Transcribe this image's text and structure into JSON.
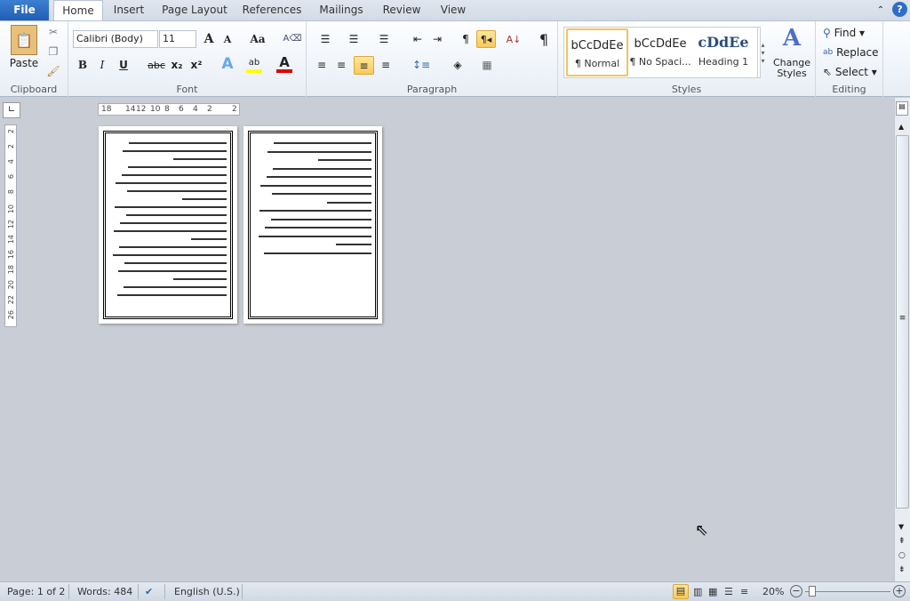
{
  "tabs": [
    {
      "label": "File"
    },
    {
      "label": "Home"
    },
    {
      "label": "Insert"
    },
    {
      "label": "Page Layout"
    },
    {
      "label": "References"
    },
    {
      "label": "Mailings"
    },
    {
      "label": "Review"
    },
    {
      "label": "View"
    }
  ],
  "clipboard": {
    "paste": "Paste",
    "label": "Clipboard"
  },
  "font": {
    "name": "Calibri (Body)",
    "size": "11",
    "label": "Font",
    "change_case": "Aa",
    "bold": "B",
    "italic": "I",
    "underline": "U",
    "strike": "abc",
    "sub": "x₂",
    "sup": "x²",
    "highlight": "ab",
    "color": "A",
    "grow": "A",
    "shrink": "A"
  },
  "paragraph": {
    "label": "Paragraph",
    "pilcrow": "¶"
  },
  "styles": {
    "label": "Styles",
    "items": [
      {
        "preview": "bCcDdEe",
        "name": "¶ Normal"
      },
      {
        "preview": "bCcDdEe",
        "name": "¶ No Spaci..."
      },
      {
        "preview": "cDdEe",
        "name": "Heading 1"
      }
    ],
    "change": "Change Styles"
  },
  "editing": {
    "label": "Editing",
    "find": "Find",
    "replace": "Replace",
    "select": "Select"
  },
  "ruler": {
    "h": [
      "18",
      "14",
      "12",
      "10",
      "8",
      "6",
      "4",
      "2",
      "2"
    ],
    "v": [
      "2",
      "2",
      "4",
      "6",
      "8",
      "10",
      "12",
      "14",
      "16",
      "18",
      "20",
      "22",
      "26"
    ]
  },
  "status": {
    "page": "Page: 1 of 2",
    "words": "Words: 484",
    "language": "English (U.S.)",
    "zoom": "20%"
  },
  "colors": {
    "accent": "#1f5fb4",
    "highlight": "#f8c95a"
  }
}
